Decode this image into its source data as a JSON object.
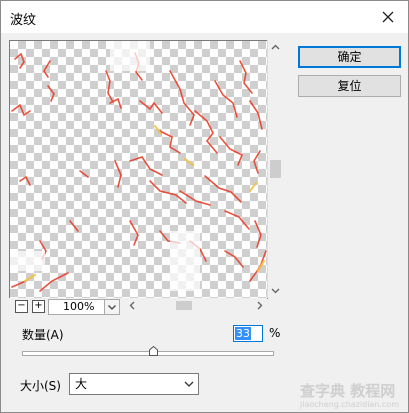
{
  "window": {
    "title": "波纹"
  },
  "buttons": {
    "ok": "确定",
    "reset": "复位"
  },
  "preview": {
    "zoom_out": "−",
    "zoom_in": "+",
    "zoom_value": "100%"
  },
  "amount": {
    "label": "数量(A)",
    "value": "33",
    "unit": "%"
  },
  "size": {
    "label": "大小(S)",
    "value": "大"
  },
  "watermark": {
    "main": "查字典 教程网",
    "sub": "jiaocheng.chazidian.com"
  },
  "colors": {
    "accent": "#0078d7",
    "ripple_red": "#e8402a",
    "ripple_yellow": "#f5c242"
  }
}
